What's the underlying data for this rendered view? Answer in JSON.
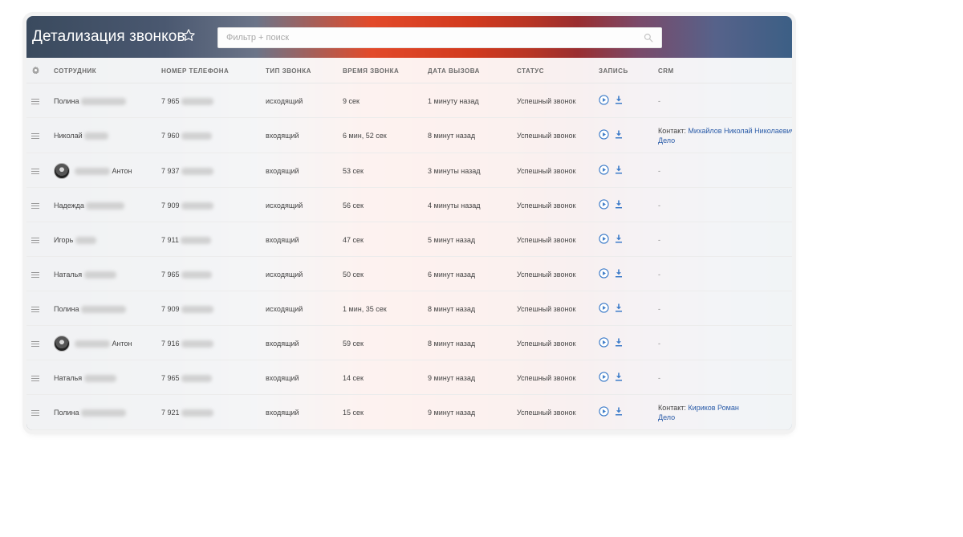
{
  "header": {
    "title": "Детализация звонков",
    "search_placeholder": "Фильтр + поиск"
  },
  "columns": {
    "employee": "СОТРУДНИК",
    "phone": "НОМЕР ТЕЛЕФОНА",
    "call_type": "ТИП ЗВОНКА",
    "duration": "ВРЕМЯ ЗВОНКА",
    "date": "ДАТА ВЫЗОВА",
    "status": "СТАТУС",
    "record": "ЗАПИСЬ",
    "crm": "CRM"
  },
  "crm_contact_label": "Контакт:",
  "rows": [
    {
      "name": "Полина",
      "phone": "7 965",
      "type": "исходящий",
      "duration": "9 сек",
      "date": "1 минуту назад",
      "status": "Успешный звонок",
      "crm": "-"
    },
    {
      "name": "Николай",
      "phone": "7 960",
      "type": "входящий",
      "duration": "6 мин, 52 сек",
      "date": "8 минут назад",
      "status": "Успешный звонок",
      "crm_contact": "Михайлов Николай Николаевич",
      "crm_deal": "Дело"
    },
    {
      "name": "Антон",
      "phone": "7 937",
      "type": "входящий",
      "duration": "53 сек",
      "date": "3 минуты назад",
      "status": "Успешный звонок",
      "crm": "-"
    },
    {
      "name": "Надежда",
      "phone": "7 909",
      "type": "исходящий",
      "duration": "56 сек",
      "date": "4 минуты назад",
      "status": "Успешный звонок",
      "crm": "-"
    },
    {
      "name": "Игорь",
      "phone": "7 911",
      "type": "входящий",
      "duration": "47 сек",
      "date": "5 минут назад",
      "status": "Успешный звонок",
      "crm": "-"
    },
    {
      "name": "Наталья",
      "phone": "7 965",
      "type": "исходящий",
      "duration": "50 сек",
      "date": "6 минут назад",
      "status": "Успешный звонок",
      "crm": "-"
    },
    {
      "name": "Полина",
      "phone": "7 909",
      "type": "исходящий",
      "duration": "1 мин, 35 сек",
      "date": "8 минут назад",
      "status": "Успешный звонок",
      "crm": "-"
    },
    {
      "name": "Антон",
      "phone": "7 916",
      "type": "входящий",
      "duration": "59 сек",
      "date": "8 минут назад",
      "status": "Успешный звонок",
      "crm": "-"
    },
    {
      "name": "Наталья",
      "phone": "7 965",
      "type": "входящий",
      "duration": "14 сек",
      "date": "9 минут назад",
      "status": "Успешный звонок",
      "crm": "-"
    },
    {
      "name": "Полина",
      "phone": "7 921",
      "type": "входящий",
      "duration": "15 сек",
      "date": "9 минут назад",
      "status": "Успешный звонок",
      "crm_contact": "Кириков Роман",
      "crm_deal": "Дело"
    }
  ]
}
